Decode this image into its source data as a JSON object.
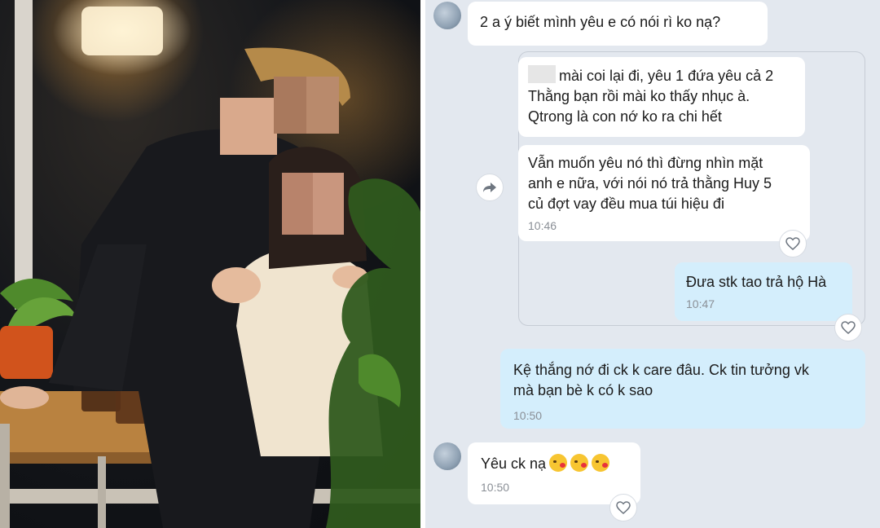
{
  "chat": {
    "messages": [
      {
        "id": "m1",
        "direction": "incoming",
        "text": "2 a ý biết mình yêu e có nói rì ko nạ?",
        "time": ""
      },
      {
        "id": "m2",
        "direction": "incoming",
        "text": "mài coi lại đi, yêu 1 đứa yêu cả 2\nThằng bạn rồi mài ko thấy nhục à.\nQtrong là con nớ ko ra chi hết",
        "time": ""
      },
      {
        "id": "m3",
        "direction": "incoming",
        "text": "Vẫn muốn yêu nó thì đừng nhìn mặt\nanh e nữa, với nói nó trả thằng Huy 5\ncủ đợt vay đều mua túi hiệu đi",
        "time": "10:46"
      },
      {
        "id": "m4",
        "direction": "outgoing",
        "text": "Đưa stk tao trả hộ Hà",
        "time": "10:47"
      },
      {
        "id": "m5",
        "direction": "outgoing",
        "text": "Kệ thắng nớ đi ck k care đâu. Ck tin tưởng vk\nmà bạn bè k có k sao",
        "time": "10:50"
      },
      {
        "id": "m6",
        "direction": "incoming",
        "text": "Yêu ck nạ",
        "time": "10:50"
      }
    ]
  },
  "icons": {
    "heart": "heart-outline-icon",
    "forward": "forward-arrow-icon",
    "emoji": "kissing-face-emoji"
  },
  "colors": {
    "chat_bg": "#e3e8ef",
    "incoming_bubble": "#ffffff",
    "outgoing_bubble": "#d4eefc",
    "time_text": "#8a8f96"
  }
}
